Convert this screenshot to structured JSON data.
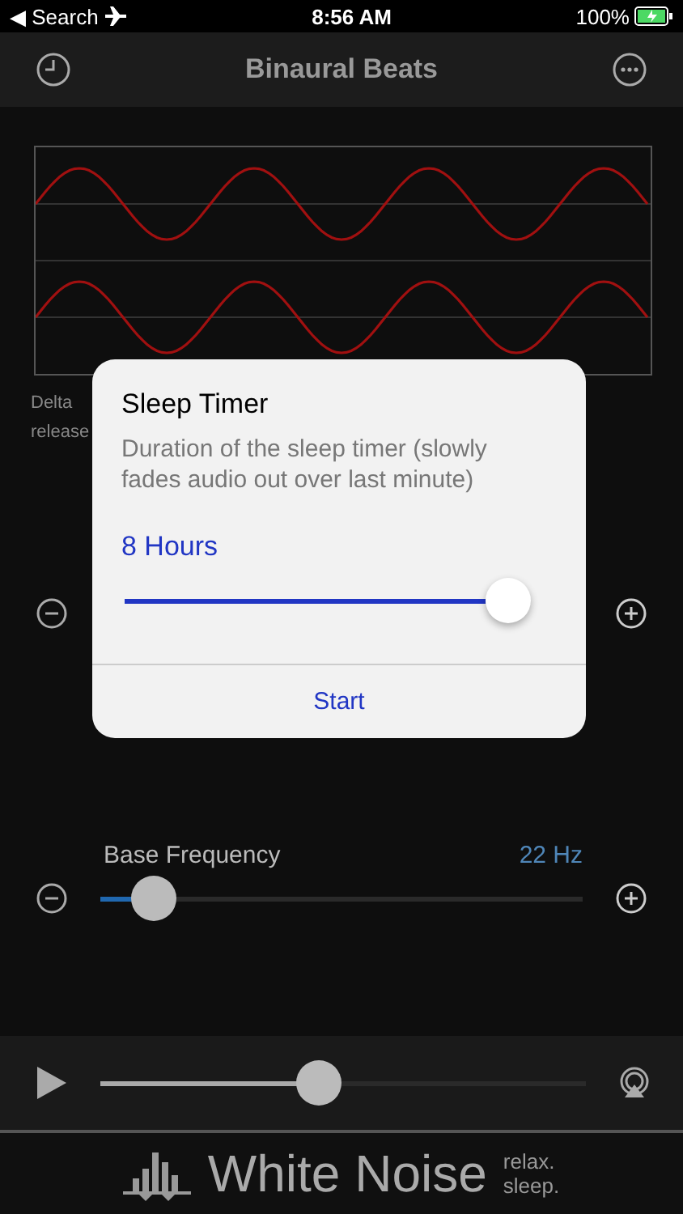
{
  "status_bar": {
    "back_arrow": "◀",
    "back_label": "Search",
    "time": "8:56 AM",
    "battery": "100%"
  },
  "nav": {
    "title": "Binaural Beats"
  },
  "description_fragments": [
    "Delta",
    "release"
  ],
  "sliders": [
    {
      "label": "Base Frequency",
      "reading": "22 Hz",
      "level": 0.11
    }
  ],
  "player": {
    "level": 0.45
  },
  "dialog": {
    "title": "Sleep Timer",
    "message": "Duration of the sleep timer (slowly fades audio out over last minute)",
    "value": "8 Hours",
    "level": 1.0,
    "button": "Start"
  },
  "banner": {
    "name": "White Noise",
    "tagline_1": "relax.",
    "tagline_2": "sleep."
  }
}
